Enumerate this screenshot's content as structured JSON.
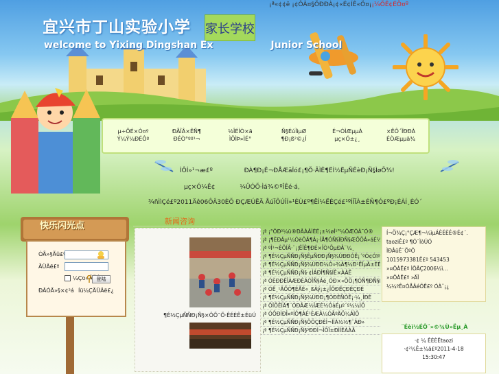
{
  "header": {
    "top_links": "¡ª«¢¢ê ¡¢ÔÂ¤§ÕÐÐÀ¡¢«É¢ÍÊ«Ö¤¡",
    "top_links_red": "¡¼ÕÊ¢ÉÖ¤º",
    "school_name": "宜兴市丁山实验小学",
    "badge": "家长学校",
    "welcome_left": "welcome to Yixing Dingshan Ex",
    "welcome_right": "Junior School"
  },
  "nav": {
    "items": [
      {
        "line1": "µ÷ÕÉ×Ò¤º",
        "line2": "Ý¼Ý¼ÐÉÔº"
      },
      {
        "line1": "ÐÃÎÂ×ÊÑ¶",
        "line2": "ÐÉÒ°ºº¹¬"
      },
      {
        "line1": "½ÎÉÌÒ×ä",
        "line2": "ÌÖÌÞ»ÌÉ°"
      },
      {
        "line1": "Ñ§ÉúÌìµØ",
        "line2": "¶Ð¡ß²©¿Í"
      },
      {
        "line1": "É¬ÓÌÆµµÀ",
        "line2": "µç×Ó±¿¸"
      },
      {
        "line1": "×ÊÔ´ÏÐÐÀ",
        "line2": "ÉÒÆµµä¾"
      }
    ]
  },
  "notice": {
    "line1_a": "ÌÔÍ»¹¬æ£º",
    "line1_b": "ÐÀ¶Ð¡Ê¬ÐÅÆäÎó£¡¶Õ·ÃÌÊ¶ËÌ½ËµÑÊèÐ¡Ñ§ÌøÕ¾!",
    "line2_a": "µç×Ó¼Ê¢",
    "line2_b": "¼ÛÓÕ·Ìá¾©ºÎÊé·á,",
    "footer": "¾ñÌìÇé£º2011Äê06ÔÂ30ÈÕ ÐÇÆÚËÄ ÅúÏÔÚÎÍ»¹ÉÙ£º¶ËÌ¼ËÉÇé£¹ºÍÎÏÀ±ÉÑ¶Ó£ºÐ¡ÉÀÍ¸ÈÓ´"
  },
  "login": {
    "title": "快乐闪光点",
    "username_label": "ÓÃ»§Ãû£º",
    "password_label": "ÃÜÂë£º",
    "remember_label": "¼Çס»ÃÜÂë",
    "login_button": "登陆",
    "register_link": "ÐÂÓÃ»§×¢²á",
    "forgot_link": "Íü¼ÇÃÜÂë£¿",
    "username_value": "",
    "password_value": ""
  },
  "news": {
    "title": "新闻咨询",
    "photo_caption": "¶É½ÇµÑÑÐ¡Ñ§×ÔÕ¯Õ·Ê­ÉÈÊ±ÉüÚ",
    "items": [
      "¡ª ¡°ÔÐ²¼ü®ÐÂÀÂÌÈÉ¡±½øÍ¹°¼ÔÆÓÀ¯Ó®",
      "¡ª ¡¶ÈÐÁµ¹¼ÓëÔÄ¶Á¡·ÍÅ¶ÓÑ§ÏÐÑ§ÆÕÖÁ»áÉ½",
      "¡ª ºÌ¹¬ÈÕÍÂ·¨¡¦ËÎÊ¶ÐÉ×ÎÒ¹ÕµÐÂ¨¼¸",
      "¡ª ¶É½ÇµÑÑÐ¡Ñ§ÊµÑÐÐ¡Ñ§¾ÙÐÐÓÊ¡´ºÓ¢ÓïºÊ",
      "¡ª ¶É½ÇµÑÑÐ¡Ñ§¾ÙÐÐ¼Ò»¾Á¶¼Ð¹ÊÏµÄ±ÈÈü",
      "¡ª ¶É½ÇµÑÑÐ¡Ñ§·¢ÍÁÐÎ¶Ñ§ÍÊ×ÀÀÊ",
      "¡ª ÓÈÐÐËÎÀÆÐÈÁÓÎÑ§Áé¸ÓÐ×«ÕÖ¡¶ÓÑ¶ÐÑ§É¶",
      "¡ª ÒÊ¸¹ÂÕÒ¶ÈÃÈ«¸ßÀý¡±¿ÎÔÐËÇÐÈÇÐÈ",
      "¡ª ¶É½ÇµÑÑÐ¡Ñ§¾ÙÐÐ¡¶ÓÐÉÑÓÊ¡·¼¸ÌÐÈ",
      "¡ª ÖÏÕÊÍÄ¶¨ÓÐÂÆ½ÎÆÈ½ÓàÉµº´º¼¼ÌÖ",
      "¡ª ÓÕÐÌÐÎ¤ºÍÔ¶ÀÉ¹ÈÆÂ¼ÓÃºÄÖ¼ÁÌÔ",
      "¡ª ¶É½ÇµÑÑÐ¡Ñ§ÔÖÇÐÉÌ¬ÌÌÀ½½¶¨ÀÐ»",
      "¡ª ¶É½ÇµÑÑÐ¡Ñ§³ÐÐÌ¬ÎÔÏ±ÐÍÍÊÁÀÃ"
    ]
  },
  "right_panel": {
    "lines": [
      "Í¬Ö¾Ç¡°ÇÆ¶¬¼ìµÁÈÉÈÉ®É¢´.",
      "taoziÊ£º ¶Ó¯ÌòÚÓ",
      "ÌÐÂûÊ¨ÕºÔ",
      "1015973381Ê£º 543453",
      "»¤ÖÀÊ£º ÌÖÂÇ2006½ì...",
      "»¤ÖÀÊ£º »ÄÎ",
      "¼¼ºÊ¤ÓÅÂéÖÊ£º ÓÀ¨¡¿"
    ],
    "guest_title": "¨Éèì½ÉÔ¨»©¾Ù»Ëµ¸À",
    "guest_lines": [
      "·¢ ¼ ÊÉÈËtaozi",
      "·¢²¼Ê±¼ä£º2011-4-18",
      "15:30:47"
    ]
  },
  "colors": {
    "title_white": "#ffffff",
    "badge_green": "#a4d95c",
    "news_orange": "#e16b1a",
    "guest_green": "#2a9a2a"
  }
}
